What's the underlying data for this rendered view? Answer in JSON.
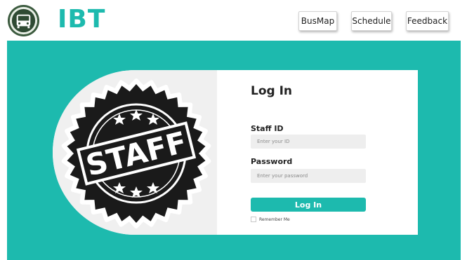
{
  "header": {
    "logo_icon": "bus-emblem-icon",
    "brand": "IBT",
    "nav": [
      {
        "label": "BusMap"
      },
      {
        "label": "Schedule"
      },
      {
        "label": "Feedback"
      }
    ]
  },
  "hero": {
    "stamp_icon": "staff-seal-icon",
    "stamp_text": "STAFF"
  },
  "login": {
    "title": "Log In",
    "staff_id_label": "Staff ID",
    "staff_id_placeholder": "Enter your ID",
    "password_label": "Password",
    "password_placeholder": "Enter your password",
    "submit_label": "Log In",
    "remember_label": "Remember Me"
  },
  "colors": {
    "accent": "#1dbaae",
    "card_left_bg": "#f0f0f0",
    "seal": "#1a1a1a"
  }
}
